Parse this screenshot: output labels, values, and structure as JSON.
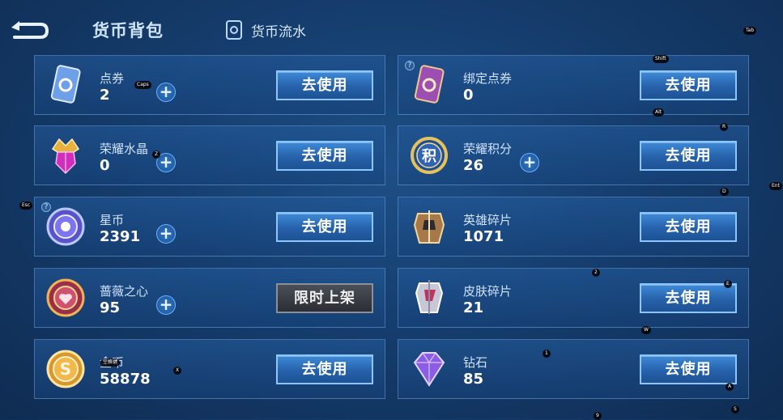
{
  "header": {
    "title": "货币背包",
    "flow_tab": "货币流水"
  },
  "colors": {
    "accent": "#3f8ad8",
    "card_border": "#78aae6",
    "limited": "#2b2e33"
  },
  "cards": [
    {
      "name": "点券",
      "value": "2",
      "icon": "coupon-card-icon",
      "plus": true,
      "button": "去使用"
    },
    {
      "name": "绑定点券",
      "value": "0",
      "icon": "bound-coupon-card-icon",
      "plus": false,
      "button": "去使用"
    },
    {
      "name": "荣耀水晶",
      "value": "0",
      "icon": "glory-crystal-icon",
      "plus": true,
      "button": "去使用"
    },
    {
      "name": "荣耀积分",
      "value": "26",
      "icon": "glory-points-icon",
      "icon_text": "积",
      "plus": true,
      "button": "去使用"
    },
    {
      "name": "星币",
      "value": "2391",
      "icon": "star-coin-icon",
      "plus": true,
      "button": "去使用"
    },
    {
      "name": "英雄碎片",
      "value": "1071",
      "icon": "hero-fragment-icon",
      "plus": false,
      "button": "去使用"
    },
    {
      "name": "蔷薇之心",
      "value": "95",
      "icon": "rose-heart-icon",
      "plus": true,
      "button": "限时上架"
    },
    {
      "name": "皮肤碎片",
      "value": "21",
      "icon": "skin-fragment-icon",
      "plus": false,
      "button": "去使用"
    },
    {
      "name": "金币",
      "value": "58878",
      "icon": "gold-coin-icon",
      "icon_text": "S",
      "plus": false,
      "button": "去使用"
    },
    {
      "name": "钻石",
      "value": "85",
      "icon": "diamond-icon",
      "plus": false,
      "button": "去使用"
    }
  ],
  "plus_symbol": "+",
  "help_symbol": "?",
  "key_hints": [
    "Tab",
    "Shift",
    "Caps",
    "Alt",
    "R",
    "Z",
    "D",
    "E",
    "2",
    "W",
    "X",
    "1",
    "A",
    "S",
    "9",
    "Esc",
    "Ent",
    "空格键"
  ]
}
